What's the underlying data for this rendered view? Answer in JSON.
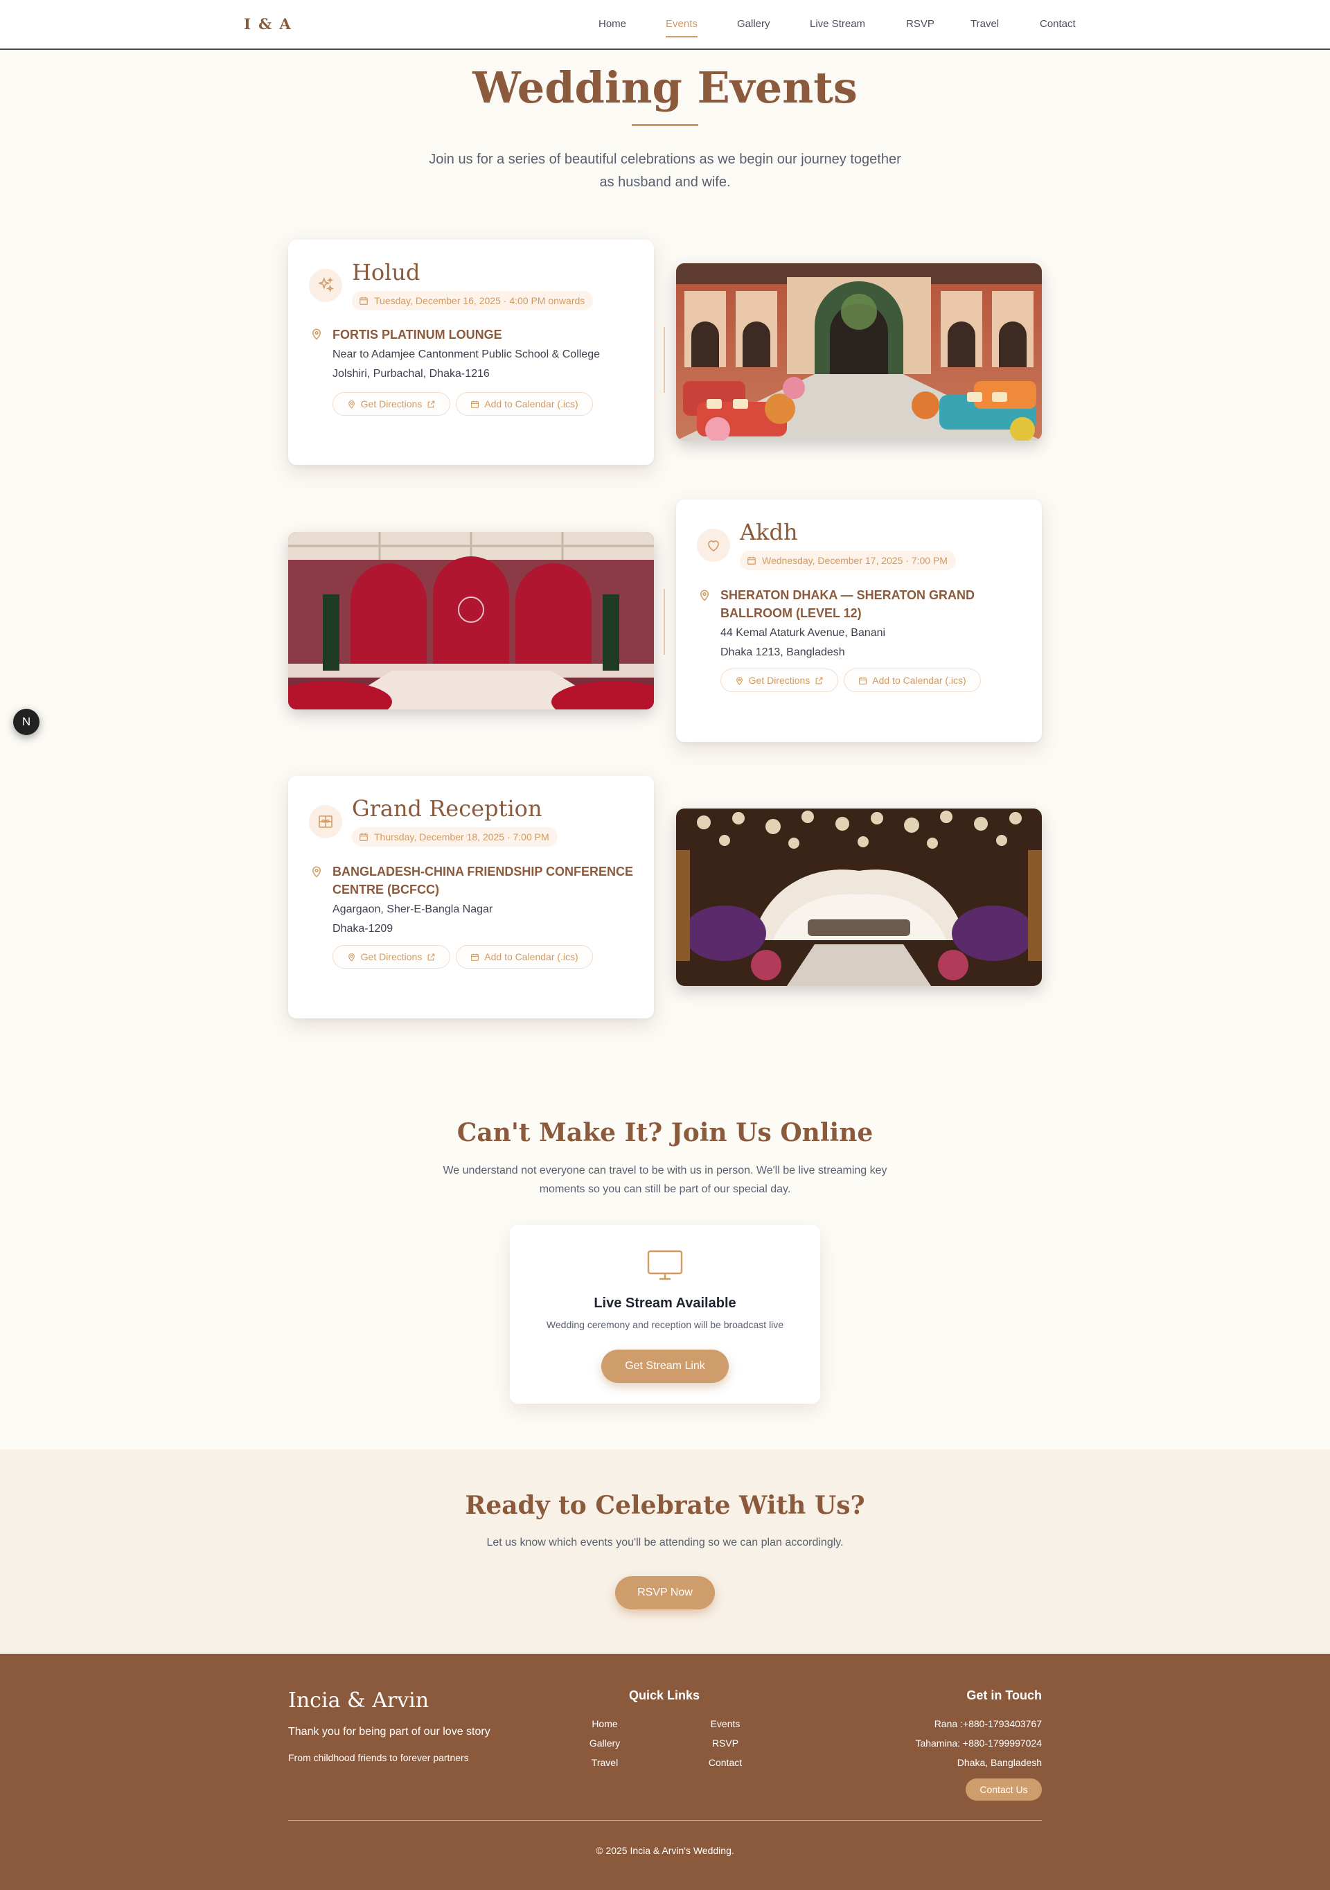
{
  "nav": {
    "logo": "I & A",
    "links": [
      "Home",
      "Events",
      "Gallery",
      "Live Stream",
      "RSVP",
      "Travel",
      "Contact"
    ],
    "active": "Events"
  },
  "hero": {
    "title": "Wedding Events",
    "subtitle": "Join us for a series of beautiful celebrations as we begin our journey together as husband and wife."
  },
  "events": [
    {
      "title": "Holud",
      "date": "Tuesday, December 16, 2025 · 4:00 PM onwards",
      "venue": "FORTIS PLATINUM LOUNGE",
      "address_line1": "Near to Adamjee Cantonment Public School & College",
      "address_line2": "Jolshiri, Purbachal, Dhaka-1216",
      "directions_label": "Get Directions",
      "calendar_label": "Add to Calendar (.ics)",
      "icon": "sparkles-icon"
    },
    {
      "title": "Akdh",
      "date": "Wednesday, December 17, 2025 · 7:00 PM",
      "venue": "SHERATON DHAKA — SHERATON GRAND BALLROOM (LEVEL 12)",
      "address_line1": "44 Kemal Ataturk Avenue, Banani",
      "address_line2": "Dhaka 1213, Bangladesh",
      "directions_label": "Get Directions",
      "calendar_label": "Add to Calendar (.ics)",
      "icon": "heart-icon"
    },
    {
      "title": "Grand Reception",
      "date": "Thursday, December 18, 2025 · 7:00 PM",
      "venue": "BANGLADESH-CHINA FRIENDSHIP CONFERENCE CENTRE (BCFCC)",
      "address_line1": "Agargaon, Sher-E-Bangla Nagar",
      "address_line2": "Dhaka-1209",
      "directions_label": "Get Directions",
      "calendar_label": "Add to Calendar (.ics)",
      "icon": "gift-icon"
    }
  ],
  "floating_badge": "N",
  "live": {
    "title": "Can't Make It? Join Us Online",
    "subtitle": "We understand not everyone can travel to be with us in person. We'll be live streaming key moments so you can still be part of our special day.",
    "card_title": "Live Stream Available",
    "card_subtitle": "Wedding ceremony and reception will be broadcast live",
    "button": "Get Stream Link",
    "icon": "monitor-icon"
  },
  "cta": {
    "title": "Ready to Celebrate With Us?",
    "subtitle": "Let us know which events you'll be attending so we can plan accordingly.",
    "button": "RSVP Now"
  },
  "footer": {
    "brand": "Incia & Arvin",
    "tagline": "Thank you for being part of our love story",
    "tagline2": "From childhood friends to forever partners",
    "quick_links_title": "Quick Links",
    "quick_links": [
      "Home",
      "Events",
      "Gallery",
      "RSVP",
      "Travel",
      "Contact"
    ],
    "contact_title": "Get in Touch",
    "contact_lines": [
      "Rana :+880-1793403767",
      "Tahamina: +880-1799997024",
      "Dhaka, Bangladesh"
    ],
    "contact_button": "Contact Us",
    "copyright": "© 2025 Incia & Arvin's Wedding."
  },
  "colors": {
    "brand_brown": "#8b5a3c",
    "accent_gold": "#d09a62",
    "button": "#cf9c6c",
    "page_bg": "#fcfaf5"
  }
}
